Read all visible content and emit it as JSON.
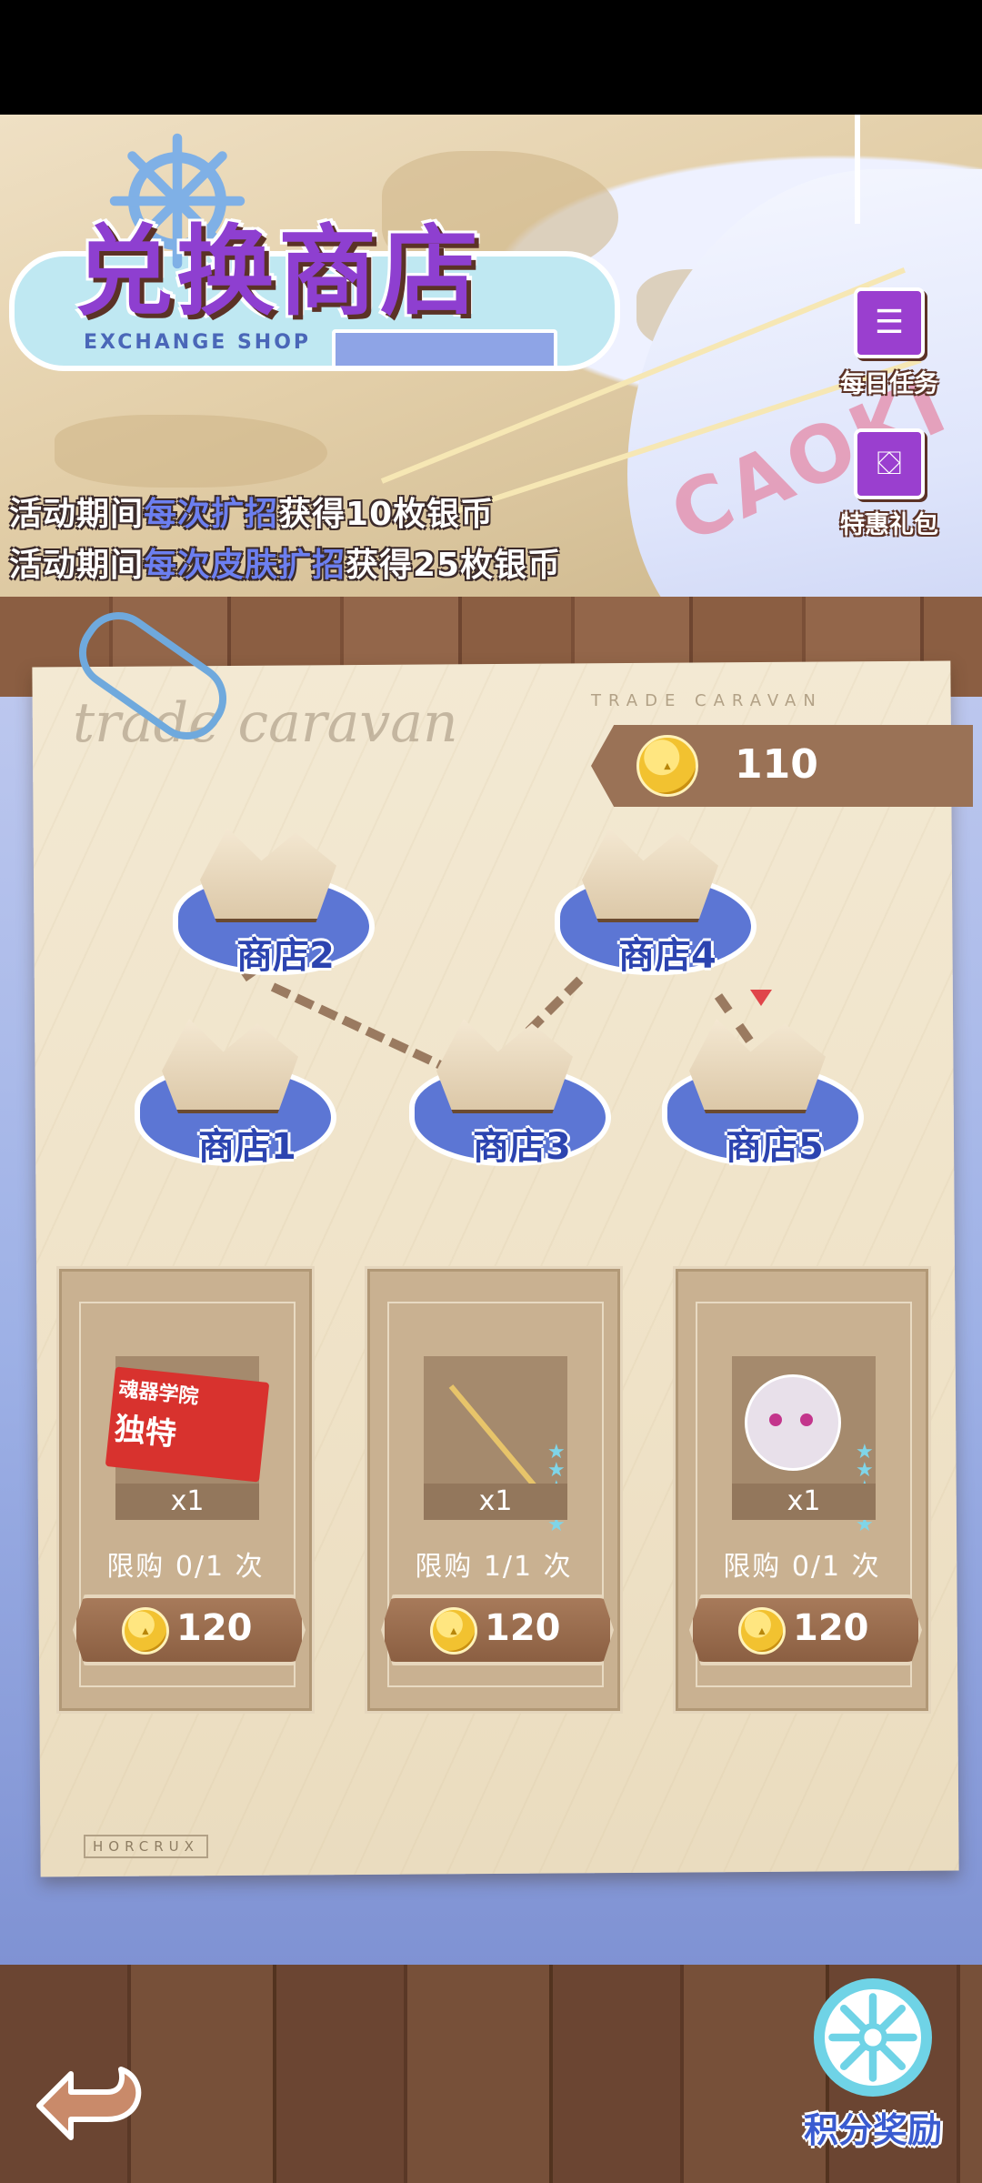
{
  "header": {
    "title": "兑换商店",
    "subtitle": "EXCHANGE SHOP",
    "sail_text": "CAOKI"
  },
  "promo_lines": [
    {
      "prefix": "活动期间",
      "highlight": "每次扩招",
      "suffix": "获得10枚银币"
    },
    {
      "prefix": "活动期间",
      "highlight": "每次皮肤扩招",
      "suffix": "获得25枚银币"
    }
  ],
  "side_buttons": {
    "daily_tasks": "每日任务",
    "special_gift": "特惠礼包"
  },
  "paper": {
    "script_text": "trade caravan",
    "caption_top": "TRADE CARAVAN",
    "caption_bottom": "HORCRUX"
  },
  "balance": {
    "icon": "coin-icon",
    "value": "110"
  },
  "shops": [
    {
      "label": "商店1"
    },
    {
      "label": "商店2"
    },
    {
      "label": "商店3"
    },
    {
      "label": "商店4"
    },
    {
      "label": "商店5"
    }
  ],
  "items": [
    {
      "qty": "x1",
      "limit": "限购 0/1 次",
      "price": "120",
      "ticket_line1": "魂器学院",
      "ticket_line2": "独特",
      "stars": 0
    },
    {
      "qty": "x1",
      "limit": "限购 1/1 次",
      "price": "120",
      "stars": 5
    },
    {
      "qty": "x1",
      "limit": "限购 0/1 次",
      "price": "120",
      "stars": 5
    }
  ],
  "bottom": {
    "reward_label": "积分奖励",
    "back_icon": "return-arrow-icon"
  },
  "colors": {
    "accent_purple": "#8e3fd0",
    "highlight_blue": "#6c7ff0",
    "coin_gold": "#f2c230",
    "wood": "#8b5e42"
  }
}
